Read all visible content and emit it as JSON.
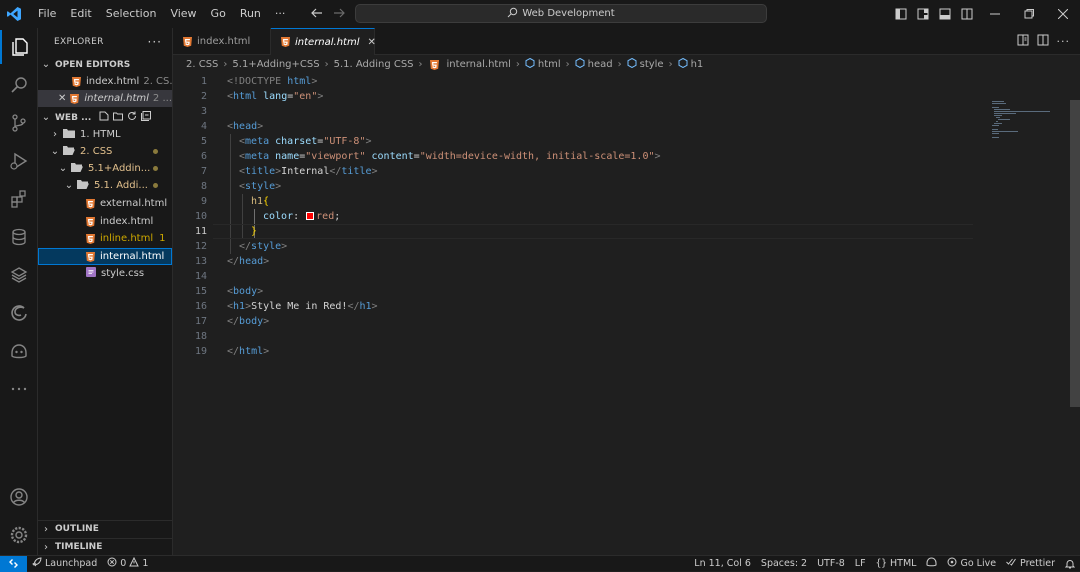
{
  "menu": [
    "File",
    "Edit",
    "Selection",
    "View",
    "Go",
    "Run",
    "···"
  ],
  "search": {
    "label": "Web Development"
  },
  "sidebar": {
    "title": "EXPLORER",
    "open_editors": "OPEN EDITORS",
    "open_files": [
      {
        "name": "index.html",
        "desc": "2. CS..."
      },
      {
        "name": "internal.html",
        "desc": "2 ..."
      }
    ],
    "workspace": "WEB ...",
    "tree": [
      {
        "name": "1. HTML",
        "type": "folder-closed"
      },
      {
        "name": "2. CSS",
        "type": "folder-open"
      },
      {
        "name": "5.1+Addin...",
        "type": "folder-open"
      },
      {
        "name": "5.1. Addi...",
        "type": "folder-open"
      },
      {
        "name": "external.html",
        "type": "html"
      },
      {
        "name": "index.html",
        "type": "html"
      },
      {
        "name": "inline.html",
        "type": "html",
        "badge": "1"
      },
      {
        "name": "internal.html",
        "type": "html"
      },
      {
        "name": "style.css",
        "type": "css"
      }
    ],
    "outline": "OUTLINE",
    "timeline": "TIMELINE"
  },
  "tabs": [
    {
      "name": "index.html"
    },
    {
      "name": "internal.html"
    }
  ],
  "breadcrumb": [
    "2. CSS",
    "5.1+Adding+CSS",
    "5.1. Adding CSS",
    "internal.html",
    "html",
    "head",
    "style",
    "h1"
  ],
  "line_numbers": [
    "1",
    "2",
    "3",
    "4",
    "5",
    "6",
    "7",
    "8",
    "9",
    "10",
    "11",
    "12",
    "13",
    "14",
    "15",
    "16",
    "17",
    "18",
    "19"
  ],
  "code": {
    "l1": {
      "a": "<!DOCTYPE ",
      "b": "html",
      "c": ">"
    },
    "l2": {
      "a": "<",
      "b": "html",
      "c": " lang",
      "d": "=",
      "e": "\"en\"",
      "f": ">"
    },
    "l4": {
      "a": "<",
      "b": "head",
      "c": ">"
    },
    "l5": {
      "a": "<",
      "b": "meta",
      "c": " charset",
      "d": "=",
      "e": "\"UTF-8\"",
      "f": ">"
    },
    "l6": {
      "a": "<",
      "b": "meta",
      "c": " name",
      "d": "=",
      "e": "\"viewport\"",
      "g": " content",
      "h": "=",
      "i": "\"width=device-width, initial-scale=1.0\"",
      "f": ">"
    },
    "l7": {
      "a": "<",
      "b": "title",
      "c": ">",
      "d": "Internal",
      "e": "</",
      "f": "title",
      "g": ">"
    },
    "l8": {
      "a": "<",
      "b": "style",
      "c": ">"
    },
    "l9": {
      "a": "h1",
      "b": "{"
    },
    "l10": {
      "a": "color",
      "b": ": ",
      "c": "red",
      "d": ";"
    },
    "l11": {
      "a": "}"
    },
    "l12": {
      "a": "</",
      "b": "style",
      "c": ">"
    },
    "l13": {
      "a": "</",
      "b": "head",
      "c": ">"
    },
    "l15": {
      "a": "<",
      "b": "body",
      "c": ">"
    },
    "l16": {
      "a": "<",
      "b": "h1",
      "c": ">",
      "d": "Style Me in Red!",
      "e": "</",
      "f": "h1",
      "g": ">"
    },
    "l17": {
      "a": "</",
      "b": "body",
      "c": ">"
    },
    "l19": {
      "a": "</",
      "b": "html",
      "c": ">"
    }
  },
  "status": {
    "launchpad": "Launchpad",
    "errors": "0",
    "warnings": "1",
    "position": "Ln 11, Col 6",
    "spaces": "Spaces: 2",
    "encoding": "UTF-8",
    "eol": "LF",
    "language": "HTML",
    "golive": "Go Live",
    "prettier": "Prettier"
  },
  "colors": {
    "accent": "#0078d4",
    "html_icon": "#e37933",
    "css_icon": "#a074c4",
    "modified": "#e2c08d"
  }
}
